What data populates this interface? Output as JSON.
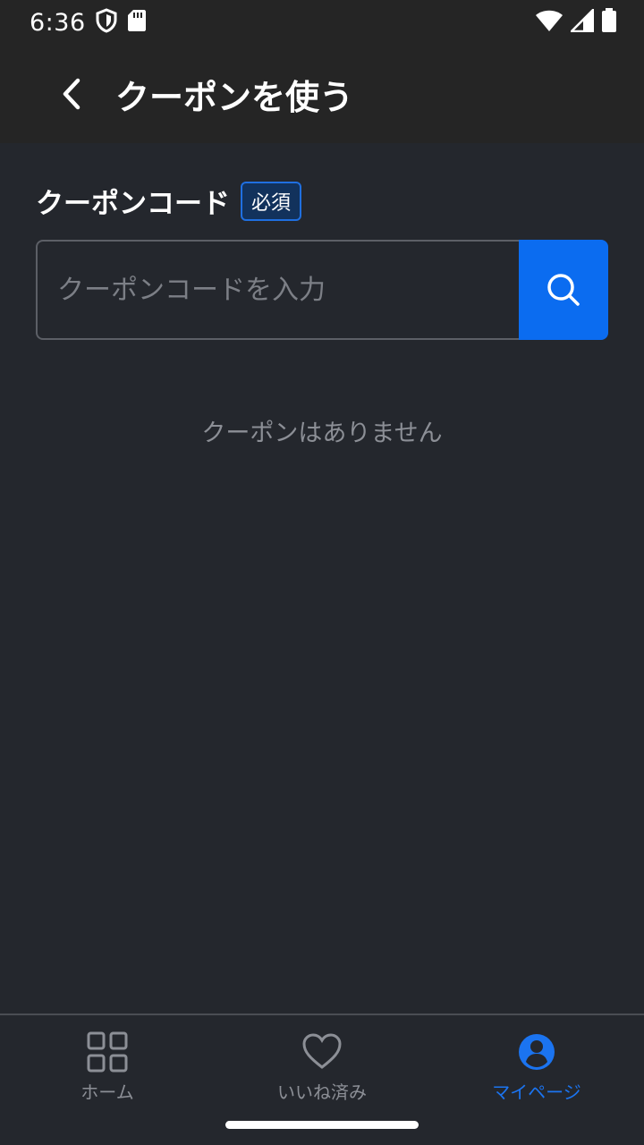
{
  "status_bar": {
    "time": "6:36",
    "icons": [
      "shield-icon",
      "sd-card-icon",
      "wifi-icon",
      "signal-icon",
      "battery-icon"
    ]
  },
  "app_bar": {
    "title": "クーポンを使う",
    "back_icon": "chevron-left-icon"
  },
  "coupon_form": {
    "label": "クーポンコード",
    "required_badge": "必須",
    "input_value": "",
    "input_placeholder": "クーポンコードを入力",
    "search_icon": "search-icon"
  },
  "empty_message": "クーポンはありません",
  "bottom_nav": {
    "items": [
      {
        "label": "ホーム",
        "icon": "grid-icon",
        "active": false
      },
      {
        "label": "いいね済み",
        "icon": "heart-icon",
        "active": false
      },
      {
        "label": "マイページ",
        "icon": "account-circle-icon",
        "active": true
      }
    ]
  },
  "colors": {
    "background": "#24272d",
    "bar": "#252525",
    "accent": "#0b6cf0",
    "muted_text": "#8c8f96"
  }
}
